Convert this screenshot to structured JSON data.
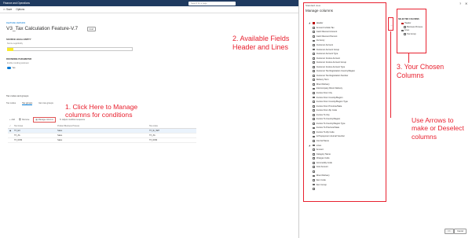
{
  "appbar": {
    "title": "Finance and Operations",
    "search_placeholder": "Search for a page"
  },
  "toolbar": {
    "save": "Save",
    "options": "Options"
  },
  "form": {
    "breadcrumb": "FEATURE VERSION",
    "title": "V3_Tax Calculation Feature-V.7",
    "badge": "Draft",
    "source_section": "SOURCE LEGAL ENTITY",
    "source_label": "Source Legal Entity",
    "rounding_section": "ROUNDING PARAMETER",
    "rounding_label": "Enable rounding parameter",
    "rounding_toggle": "Yes",
    "tab_header": "Tax codes and groups",
    "tabs": [
      "Tax codes",
      "Tax groups",
      "Item tax groups"
    ],
    "actions": [
      "Add",
      "Remove",
      "Manage columns",
      "Adjust condition sequence"
    ],
    "columns": [
      "Active Tax Group",
      "Tax Group",
      "Product Business Process",
      "Tax codes"
    ],
    "rows": [
      [
        "TX_EU",
        "Sales",
        "TX_IE_VEH"
      ],
      [
        "TX_ZA",
        "Sales",
        "TX_ZA"
      ],
      [
        "TX_DOM",
        "Sales",
        "TX_DOM"
      ]
    ]
  },
  "annotations": {
    "step1": "1. Click Here to Manage columns for conditions",
    "step2": "2. Available Fields Header and Lines",
    "step3": "3. Your Chosen Columns",
    "arrows_note": "Use Arrows to make or Deselect columns"
  },
  "panel": {
    "view": "Standard view",
    "title": "Manage columns",
    "header_item": "Header",
    "header_fields": [
      "Amount Include Tax",
      "Cash Discount Amount",
      "Cash Discount Percent",
      "Currency",
      "Customer Account",
      "Customer Account Group",
      "Customer Account Type",
      "Customer Invoice Account",
      "Customer Invoice Account Group",
      "Customer Invoice Account Type",
      "Customer Tax Registration Country/Region",
      "Customer Tax Registration Number",
      "Delivery Term",
      "Direct Delivery",
      "Intercompany Direct Delivery",
      "Invoice From City",
      "Invoice From Country/Region",
      "Invoice From Country/Region Type",
      "Invoice From Province/State",
      "Invoice From Zip Code",
      "Invoice To City",
      "Invoice To Country/Region",
      "Invoice To Country/Region Type",
      "Invoice To Province/State",
      "Invoice To Zip Code",
      "Is Prepayment Journal Voucher",
      "Journal Name"
    ],
    "lines_item": "Lines",
    "line_fields": [
      "Amount",
      "Category Name",
      "Charges Code",
      "Commodity Code",
      "Cost Amount",
      "",
      "Direct Delivery",
      "Item Code",
      "Item Group",
      ""
    ],
    "selected_header": "SELECTED COLUMNS",
    "selected": [
      {
        "label": "Header",
        "level": 1
      },
      {
        "label": "Business Process",
        "level": 2
      },
      {
        "label": "Lines",
        "level": 1
      },
      {
        "label": "Tax Group",
        "level": 2
      }
    ],
    "ok": "OK",
    "cancel": "Cancel"
  }
}
